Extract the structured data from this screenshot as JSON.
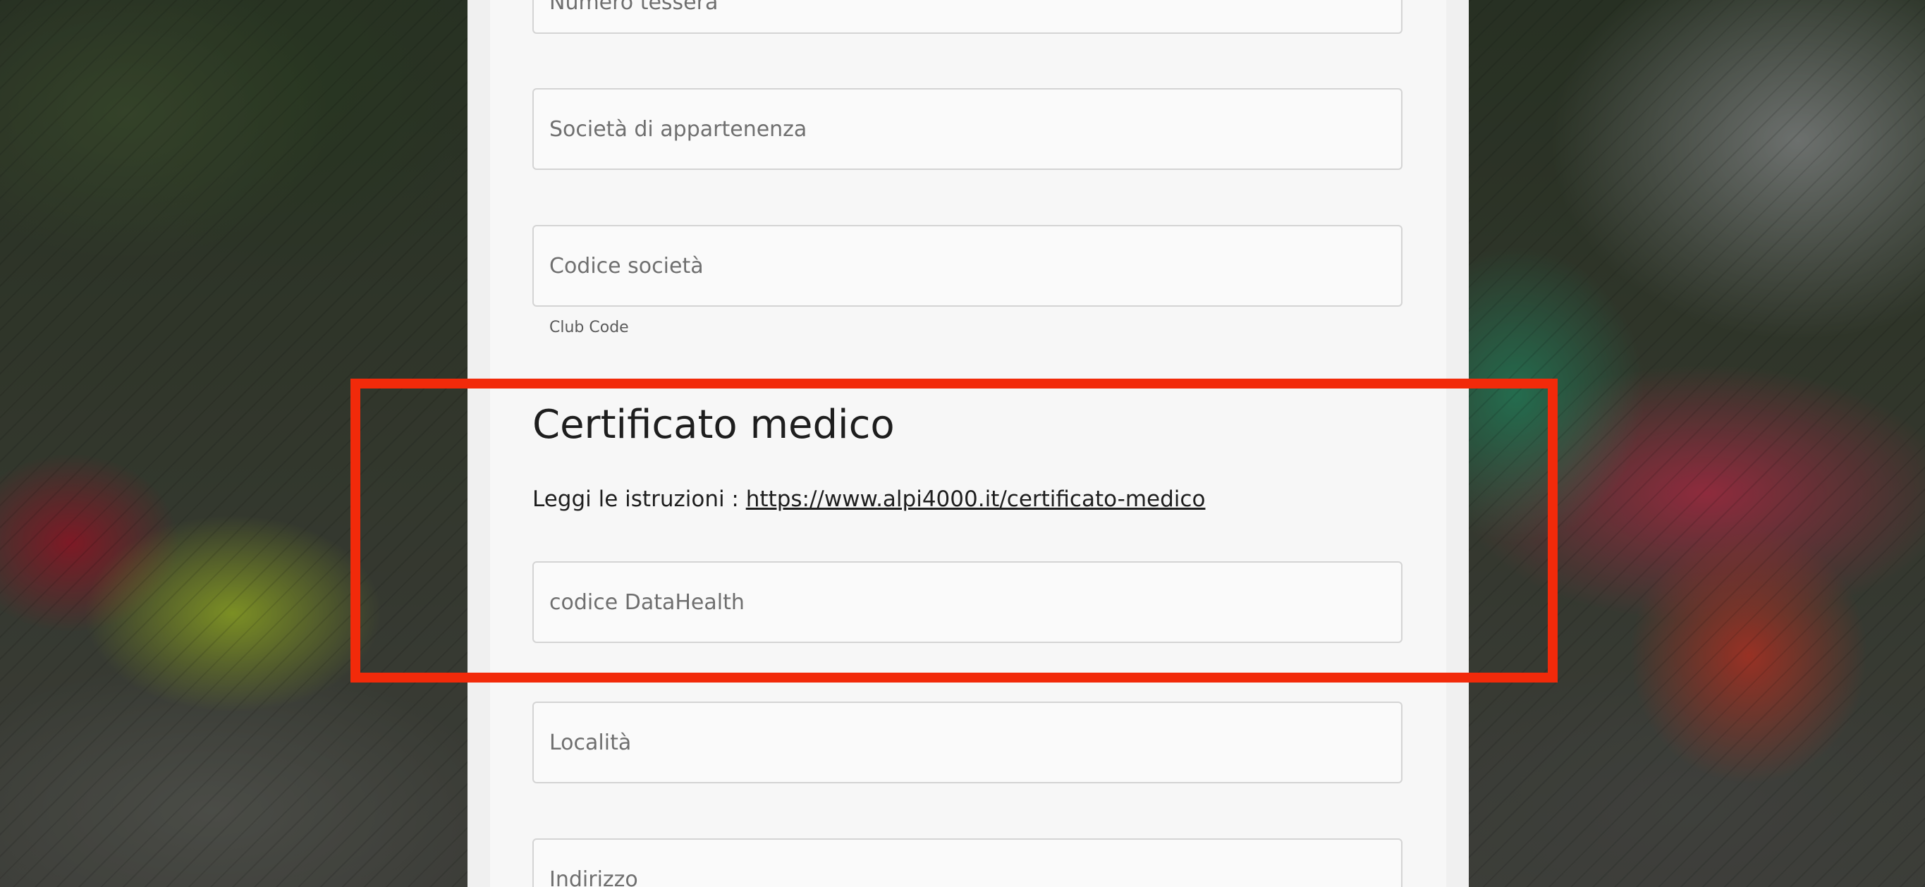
{
  "form": {
    "fields": [
      {
        "placeholder": "Numero tessera",
        "value": ""
      },
      {
        "placeholder": "Società di appartenenza",
        "value": ""
      },
      {
        "placeholder": "Codice società",
        "value": ""
      },
      {
        "placeholder": "codice DataHealth",
        "value": ""
      },
      {
        "placeholder": "Località",
        "value": ""
      },
      {
        "placeholder": "Indirizzo",
        "value": ""
      }
    ],
    "club_code_help": "Club Code"
  },
  "medical_section": {
    "title": "Certificato medico",
    "instructions_prefix": "Leggi le istruzioni : ",
    "link_text": "https://www.alpi4000.it/certificato-medico"
  },
  "colors": {
    "highlight": "#f22a0a",
    "panel": "#f7f7f7",
    "field_border": "#d4d4d4"
  }
}
